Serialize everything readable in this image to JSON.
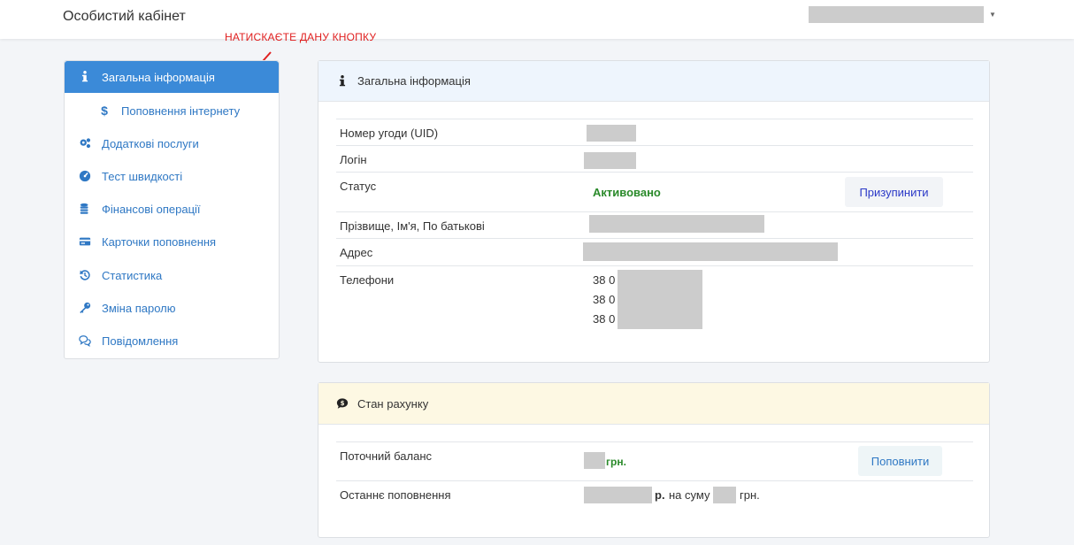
{
  "header": {
    "title": "Особистий кабінет",
    "user_caret": "▼"
  },
  "annotation": {
    "text": "НАТИСКАЄТЕ ДАНУ КНОПКУ",
    "color": "#e02020"
  },
  "sidebar": {
    "items": [
      {
        "label": "Загальна інформація",
        "icon": "info-icon",
        "active": true
      },
      {
        "label": "Поповнення інтернету",
        "icon": "dollar-icon",
        "sub": true
      },
      {
        "label": "Додаткові послуги",
        "icon": "gears-icon"
      },
      {
        "label": "Тест швидкості",
        "icon": "speedometer-icon"
      },
      {
        "label": "Фінансові операції",
        "icon": "coins-icon"
      },
      {
        "label": "Карточки поповнення",
        "icon": "card-icon"
      },
      {
        "label": "Статистика",
        "icon": "history-icon"
      },
      {
        "label": "Зміна паролю",
        "icon": "key-icon"
      },
      {
        "label": "Повідомлення",
        "icon": "chat-icon"
      }
    ]
  },
  "info_panel": {
    "title": "Загальна інформація",
    "icon": "info-icon",
    "rows": {
      "uid": "Номер угоди (UID)",
      "login": "Логін",
      "status": "Статус",
      "fullname": "Прізвище, Ім'я, По батькові",
      "address": "Адрес",
      "phones": "Телефони"
    },
    "status_value": "Активовано",
    "suspend_button": "Призупинити",
    "phone_prefixes": [
      "38 0",
      "38 0",
      "38 0"
    ]
  },
  "balance_panel": {
    "title": "Стан рахунку",
    "icon": "comment-dollar-icon",
    "current_balance_label": "Поточний баланс",
    "currency": "грн.",
    "topup_button": "Поповнити",
    "last_topup_label": "Останнє поповнення",
    "last_topup_unit": "р.",
    "last_topup_mid": "на суму",
    "last_topup_currency": "грн."
  },
  "colors": {
    "accent": "#3b8ad8",
    "link": "#2f78c4",
    "success": "#2a8a2a"
  }
}
